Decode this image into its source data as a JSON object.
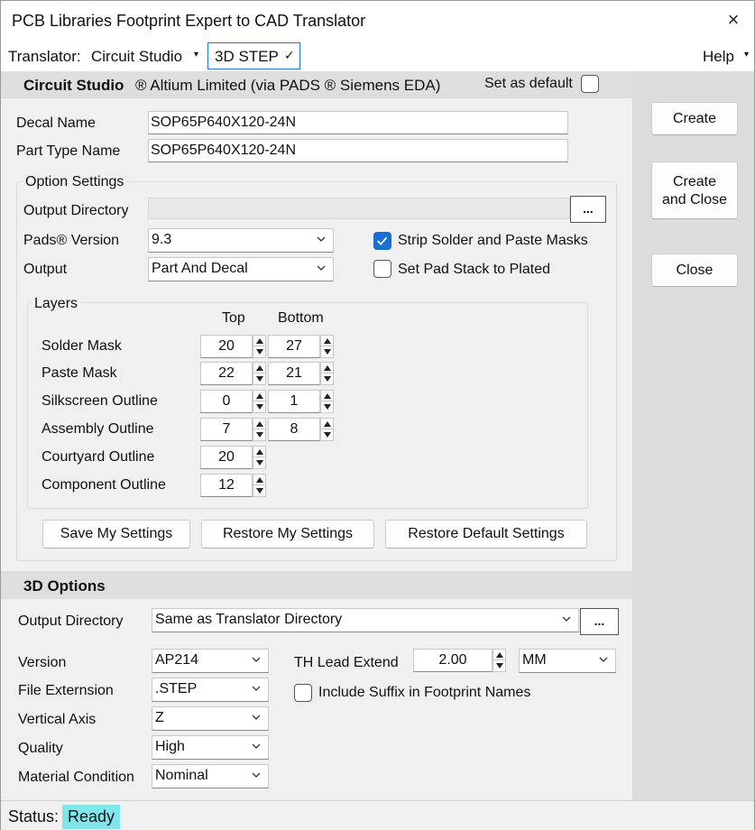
{
  "window": {
    "title": "PCB Libraries Footprint Expert to CAD Translator",
    "close_icon": "×"
  },
  "menubar": {
    "translator_label": "Translator:",
    "translator_value": "Circuit Studio",
    "format_value": "3D STEP",
    "format_check": "✓",
    "help_label": "Help"
  },
  "header": {
    "product": "Circuit Studio",
    "vendor": "® Altium Limited (via PADS ® Siemens EDA)",
    "set_default_label": "Set as default",
    "set_default_checked": false
  },
  "fields": {
    "decal_name_label": "Decal Name",
    "decal_name_value": "SOP65P640X120-24N",
    "part_type_label": "Part Type Name",
    "part_type_value": "SOP65P640X120-24N"
  },
  "option_settings": {
    "title": "Option Settings",
    "output_dir_label": "Output Directory",
    "output_dir_value": "",
    "browse_label": "...",
    "pads_version_label": "Pads® Version",
    "pads_version_value": "9.3",
    "output_label": "Output",
    "output_value": "Part And Decal",
    "strip_masks_label": "Strip Solder and Paste Masks",
    "strip_masks_checked": true,
    "pad_stack_label": "Set Pad Stack to Plated",
    "pad_stack_checked": false
  },
  "layers": {
    "title": "Layers",
    "top_header": "Top",
    "bottom_header": "Bottom",
    "rows": [
      {
        "label": "Solder Mask",
        "top": "20",
        "bottom": "27"
      },
      {
        "label": "Paste Mask",
        "top": "22",
        "bottom": "21"
      },
      {
        "label": "Silkscreen Outline",
        "top": "0",
        "bottom": "1"
      },
      {
        "label": "Assembly Outline",
        "top": "7",
        "bottom": "8"
      },
      {
        "label": "Courtyard Outline",
        "top": "20",
        "bottom": null
      },
      {
        "label": "Component Outline",
        "top": "12",
        "bottom": null
      }
    ]
  },
  "settings_buttons": {
    "save": "Save My Settings",
    "restore": "Restore My Settings",
    "restore_default": "Restore Default Settings"
  },
  "side_buttons": {
    "create": "Create",
    "create_close_line1": "Create",
    "create_close_line2": "and Close",
    "close": "Close"
  },
  "three_d": {
    "title": "3D Options",
    "output_dir_label": "Output Directory",
    "output_dir_value": "Same as Translator Directory",
    "browse_label": "...",
    "version_label": "Version",
    "version_value": "AP214",
    "file_ext_label": "File Externsion",
    "file_ext_value": ".STEP",
    "vertical_axis_label": "Vertical Axis",
    "vertical_axis_value": "Z",
    "quality_label": "Quality",
    "quality_value": "High",
    "material_label": "Material Condition",
    "material_value": "Nominal",
    "th_lead_label": "TH Lead Extend",
    "th_lead_value": "2.00",
    "unit_value": "MM",
    "include_suffix_label": "Include Suffix in Footprint Names",
    "include_suffix_checked": false
  },
  "status": {
    "label": "Status:",
    "value": "Ready"
  },
  "colors": {
    "accent": "#1a6fd0",
    "ready_bg": "#7fe7ec",
    "panel": "#f0f0f0"
  }
}
